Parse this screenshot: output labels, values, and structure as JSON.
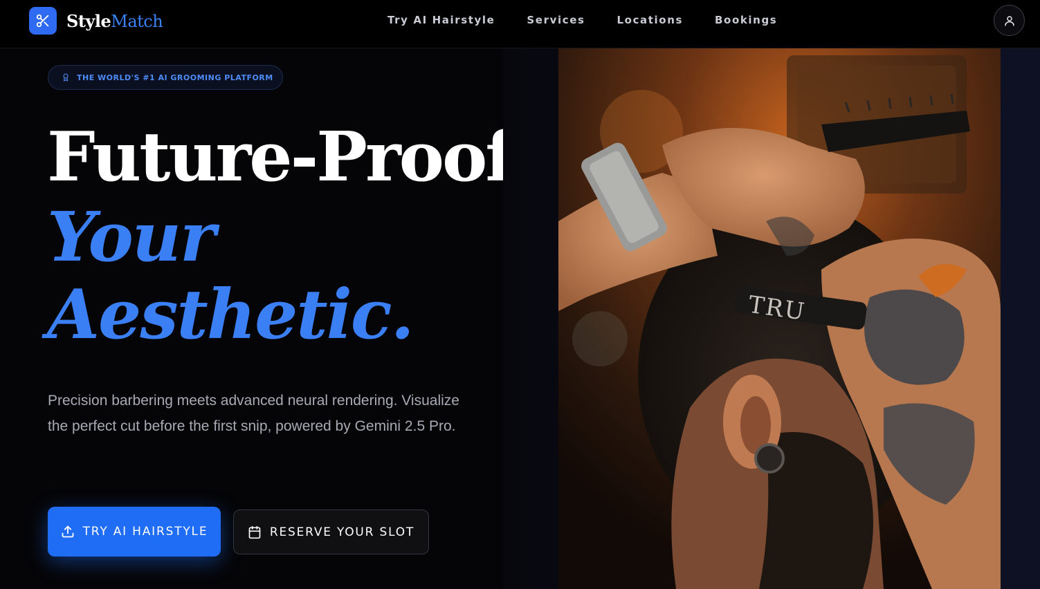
{
  "brand": {
    "name_part1": "Style",
    "name_part2": "Match",
    "logo_icon": "scissors-icon"
  },
  "nav": {
    "links": [
      {
        "label": "Try AI Hairstyle"
      },
      {
        "label": "Services"
      },
      {
        "label": "Locations"
      },
      {
        "label": "Bookings"
      }
    ],
    "account_icon": "user-icon"
  },
  "hero": {
    "badge": {
      "icon": "award-icon",
      "text": "THE WORLD'S #1 AI GROOMING PLATFORM"
    },
    "headline": {
      "line1": "Future-Proof",
      "line2": "Your",
      "line3": "Aesthetic."
    },
    "description": "Precision barbering meets advanced neural rendering. Visualize the perfect cut before the first snip, powered by Gemini 2.5 Pro.",
    "primary_cta": {
      "label": "TRY AI HAIRSTYLE",
      "icon": "upload-icon"
    },
    "secondary_cta": {
      "label": "RESERVE YOUR SLOT",
      "icon": "calendar-icon"
    },
    "image": {
      "razor_text": "TRU"
    }
  },
  "colors": {
    "accent": "#2f6bf2",
    "headline_accent": "#3b7ff5",
    "background": "#050507"
  }
}
